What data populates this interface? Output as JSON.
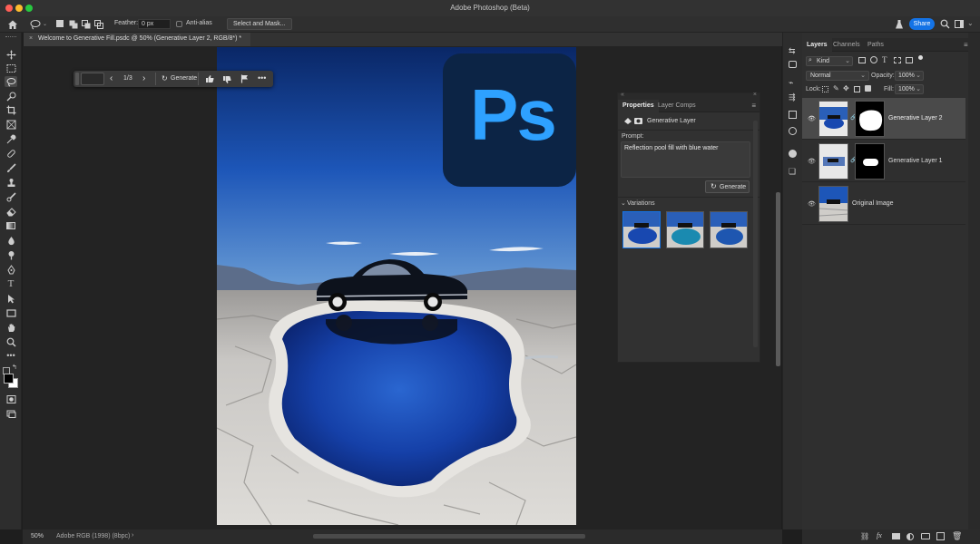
{
  "app": {
    "title": "Adobe Photoshop (Beta)"
  },
  "options": {
    "feather_label": "Feather:",
    "feather_value": "0 px",
    "antialias_label": "Anti-alias",
    "select_mask_label": "Select and Mask...",
    "share_label": "Share"
  },
  "document": {
    "tab_title": "Welcome to Generative Fill.psdc @ 50% (Generative Layer 2, RGB/8*) *"
  },
  "taskbar": {
    "counter": "1/3",
    "generate_label": "Generate"
  },
  "properties": {
    "tab_properties": "Properties",
    "tab_layer_comps": "Layer Comps",
    "layer_type": "Generative Layer",
    "prompt_label": "Prompt:",
    "prompt_text": "Reflection pool fill with blue water",
    "generate_label": "Generate",
    "variations_label": "Variations"
  },
  "canvas": {
    "logo_text": "Ps"
  },
  "layers_panel": {
    "tabs": [
      "Layers",
      "Channels",
      "Paths"
    ],
    "filter_kind": "Kind",
    "blend_mode": "Normal",
    "opacity_label": "Opacity:",
    "opacity_value": "100%",
    "lock_label": "Lock:",
    "fill_label": "Fill:",
    "fill_value": "100%",
    "layers": [
      {
        "name": "Generative Layer 2",
        "selected": true
      },
      {
        "name": "Generative Layer 1",
        "selected": false
      },
      {
        "name": "Original Image",
        "selected": false
      }
    ]
  },
  "status": {
    "zoom": "50%",
    "color_profile": "Adobe RGB (1998) (8bpc)"
  },
  "colors": {
    "accent": "#1473e6",
    "panel": "#2f2f2f",
    "canvas_bg": "#232323",
    "sky_top": "#0b2a6b",
    "pool": "#1a4fc0"
  }
}
